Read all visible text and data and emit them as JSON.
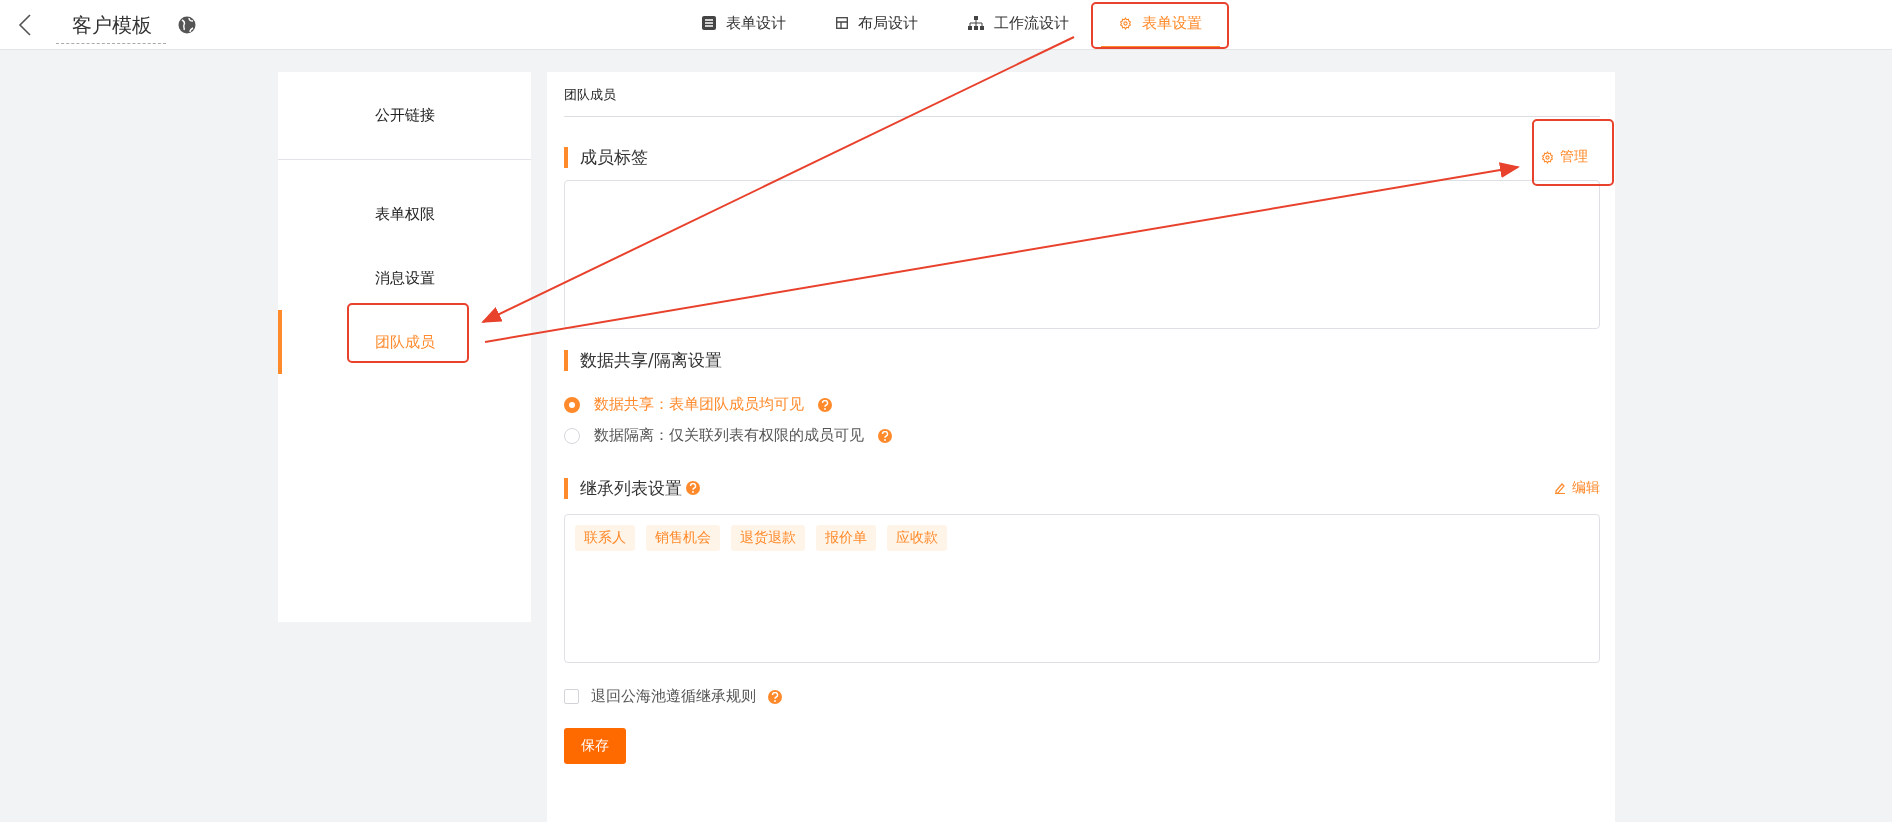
{
  "header": {
    "title": "客户模板"
  },
  "tabs": [
    {
      "label": "表单设计",
      "kind": "form",
      "selected": false
    },
    {
      "label": "布局设计",
      "kind": "layout",
      "selected": false
    },
    {
      "label": "工作流设计",
      "kind": "flow",
      "selected": false
    },
    {
      "label": "表单设置",
      "kind": "settings",
      "selected": true
    }
  ],
  "sidebar": {
    "top_items": [
      {
        "label": "公开链接",
        "selected": false
      }
    ],
    "items": [
      {
        "label": "表单权限",
        "selected": false
      },
      {
        "label": "消息设置",
        "selected": false
      },
      {
        "label": "团队成员",
        "selected": true
      }
    ]
  },
  "panel": {
    "title": "团队成员",
    "member_tags": {
      "heading": "成员标签",
      "action": "管理"
    },
    "data_share": {
      "heading": "数据共享/隔离设置",
      "options": [
        {
          "label": "数据共享：表单团队成员均可见",
          "selected": true
        },
        {
          "label": "数据隔离：仅关联列表有权限的成员可见",
          "selected": false
        }
      ]
    },
    "inherit": {
      "heading": "继承列表设置",
      "action": "编辑",
      "tags": [
        "联系人",
        "销售机会",
        "退货退款",
        "报价单",
        "应收款"
      ]
    },
    "return_rule": {
      "label": "退回公海池遵循继承规则",
      "checked": false
    },
    "save": "保存"
  }
}
